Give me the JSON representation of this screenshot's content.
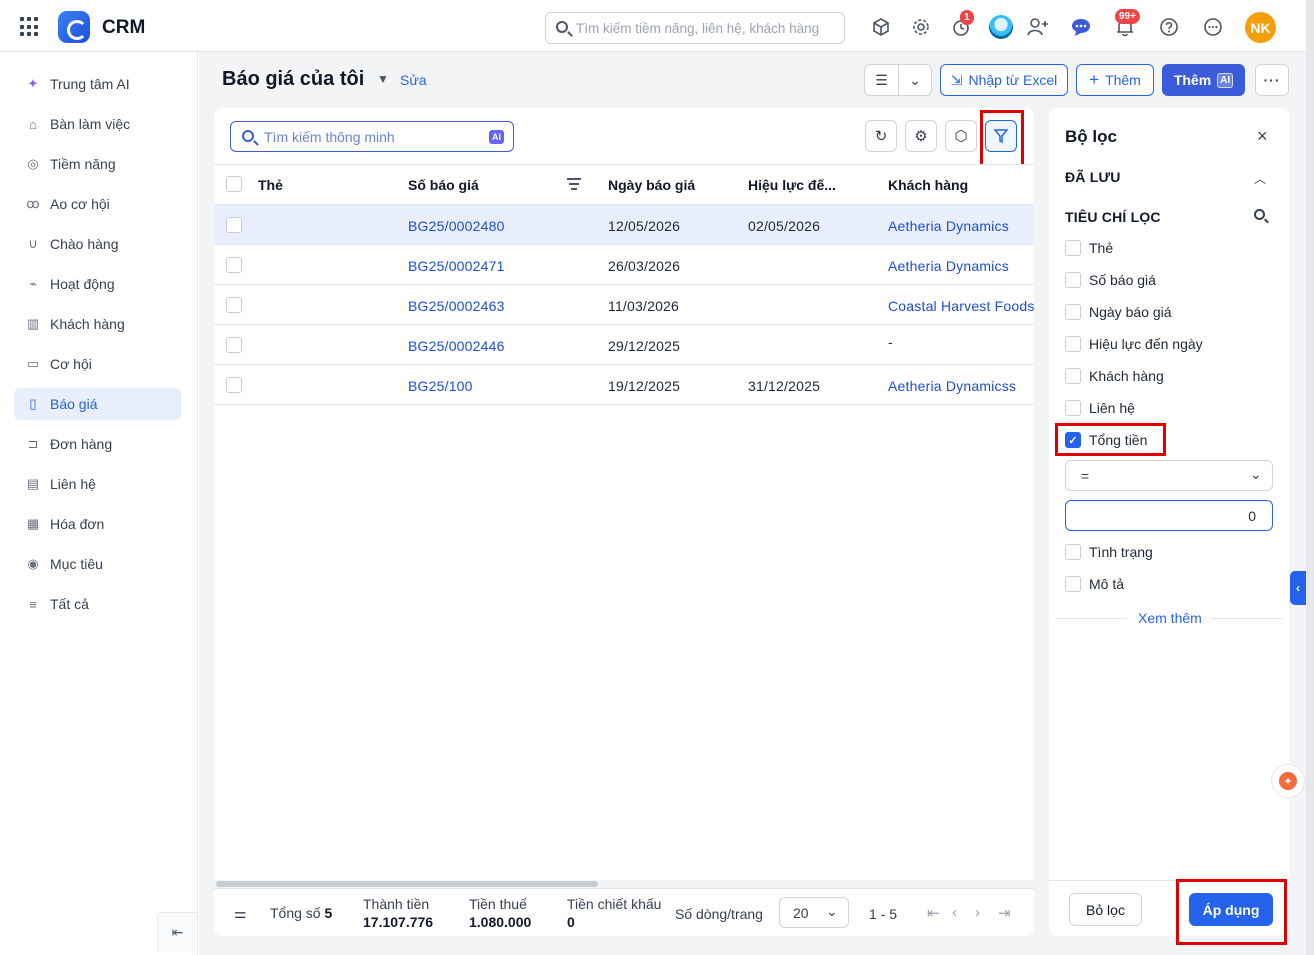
{
  "app": {
    "name": "CRM"
  },
  "header": {
    "search_placeholder": "Tìm kiếm tiềm năng, liên hệ, khách hàng",
    "timer_badge": "1",
    "notification_badge": "99+",
    "user_initials": "NK"
  },
  "sidebar": {
    "items": [
      {
        "label": "Trung tâm AI",
        "icon": "sparkle-icon"
      },
      {
        "label": "Bàn làm việc",
        "icon": "home-icon"
      },
      {
        "label": "Tiềm năng",
        "icon": "lead-icon"
      },
      {
        "label": "Ao cơ hội",
        "icon": "pool-icon"
      },
      {
        "label": "Chào hàng",
        "icon": "magnet-icon"
      },
      {
        "label": "Hoạt động",
        "icon": "activity-icon"
      },
      {
        "label": "Khách hàng",
        "icon": "building-icon"
      },
      {
        "label": "Cơ hội",
        "icon": "opportunity-icon"
      },
      {
        "label": "Báo giá",
        "icon": "quote-icon"
      },
      {
        "label": "Đơn hàng",
        "icon": "cart-icon"
      },
      {
        "label": "Liên hệ",
        "icon": "contact-icon"
      },
      {
        "label": "Hóa đơn",
        "icon": "invoice-icon"
      },
      {
        "label": "Mục tiêu",
        "icon": "target-icon"
      },
      {
        "label": "Tất cả",
        "icon": "menu-icon"
      }
    ],
    "active_index": 8
  },
  "page": {
    "title": "Báo giá của tôi",
    "edit_label": "Sửa",
    "import_label": "Nhập từ Excel",
    "add_label": "Thêm",
    "add_ai_label": "Thêm",
    "ai_chip": "AI"
  },
  "table": {
    "search_placeholder": "Tìm kiếm thông minh",
    "ai_tag": "AI",
    "columns": [
      "Thẻ",
      "Số báo giá",
      "Ngày báo giá",
      "Hiệu lực đế...",
      "Khách hàng"
    ],
    "rows": [
      {
        "tag": "",
        "number": "BG25/0002480",
        "date": "12/05/2026",
        "valid_until": "02/05/2026",
        "customer": "Aetheria Dynamics"
      },
      {
        "tag": "",
        "number": "BG25/0002471",
        "date": "26/03/2026",
        "valid_until": "",
        "customer": "Aetheria Dynamics"
      },
      {
        "tag": "",
        "number": "BG25/0002463",
        "date": "11/03/2026",
        "valid_until": "",
        "customer": "Coastal Harvest Foods"
      },
      {
        "tag": "",
        "number": "BG25/0002446",
        "date": "29/12/2025",
        "valid_until": "",
        "customer": "-"
      },
      {
        "tag": "",
        "number": "BG25/100",
        "date": "19/12/2025",
        "valid_until": "31/12/2025",
        "customer": "Aetheria Dynamicss"
      }
    ],
    "selected_row_index": 0
  },
  "footer": {
    "total_label": "Tổng số",
    "total_value": "5",
    "subtotal_label": "Thành tiền",
    "subtotal_value": "17.107.776",
    "tax_label": "Tiền thuế",
    "tax_value": "1.080.000",
    "discount_label": "Tiền chiết khấu",
    "discount_value": "0",
    "rows_per_page_label": "Số dòng/trang",
    "rows_per_page": "20",
    "range": "1 - 5"
  },
  "filter_panel": {
    "title": "Bộ lọc",
    "saved_section": "ĐÃ LƯU",
    "criteria_section": "TIÊU CHÍ LỌC",
    "criteria": [
      {
        "label": "Thẻ",
        "checked": false
      },
      {
        "label": "Số báo giá",
        "checked": false
      },
      {
        "label": "Ngày báo giá",
        "checked": false
      },
      {
        "label": "Hiệu lực đến ngày",
        "checked": false
      },
      {
        "label": "Khách hàng",
        "checked": false
      },
      {
        "label": "Liên hệ",
        "checked": false
      },
      {
        "label": "Tổng tiền",
        "checked": true
      }
    ],
    "operator": "=",
    "value": "0",
    "criteria_more": [
      {
        "label": "Tình trạng",
        "checked": false
      },
      {
        "label": "Mô tả",
        "checked": false
      }
    ],
    "see_more": "Xem thêm",
    "clear_label": "Bỏ lọc",
    "apply_label": "Áp dụng"
  },
  "colors": {
    "primary": "#2563eb",
    "highlight": "#e00000",
    "active_nav_bg": "#e8eefc",
    "avatar": "#f59e0b"
  }
}
